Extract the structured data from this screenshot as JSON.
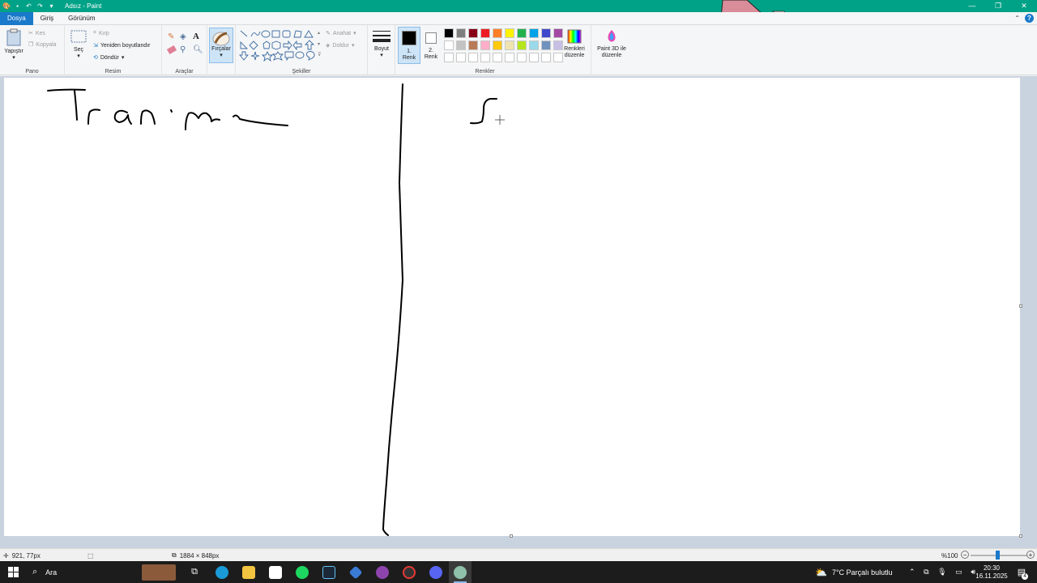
{
  "window": {
    "title": "Adsız - Paint",
    "controls": [
      "—",
      "❐",
      "✕"
    ]
  },
  "tabs": [
    {
      "label": "Dosya",
      "active": true
    },
    {
      "label": "Giriş"
    },
    {
      "label": "Görünüm"
    }
  ],
  "ribbon": {
    "clipboard": {
      "paste": "Yapıştır",
      "cut": "Kes",
      "copy": "Kopyala",
      "group": "Pano"
    },
    "image": {
      "select": "Seç",
      "crop": "Kırp",
      "resize": "Yeniden boyutlandır",
      "rotate": "Döndür",
      "group": "Resim"
    },
    "tools": {
      "group": "Araçlar"
    },
    "brushes": {
      "label": "Fırçalar"
    },
    "shapes": {
      "outline": "Anahat",
      "fill": "Doldur",
      "group": "Şekiller"
    },
    "size": {
      "label": "Boyut"
    },
    "colors": {
      "color1_label": "1. Renk",
      "color1_line1": "1.",
      "color1_line2": "Renk",
      "color2_line1": "2.",
      "color2_line2": "Renk",
      "edit_line1": "Renkleri",
      "edit_line2": "düzenle",
      "paint3d_line1": "Paint 3D ile",
      "paint3d_line2": "düzenle",
      "group": "Renkler",
      "color1": "#000000",
      "color2": "#ffffff",
      "palette_row1": [
        "#000000",
        "#7f7f7f",
        "#880015",
        "#ed1c24",
        "#ff7f27",
        "#fff200",
        "#22b14c",
        "#00a2e8",
        "#3f48cc",
        "#a349a4"
      ],
      "palette_row2": [
        "#ffffff",
        "#c3c3c3",
        "#b97a57",
        "#ffaec9",
        "#ffc90e",
        "#efe4b0",
        "#b5e61d",
        "#99d9ea",
        "#7092be",
        "#c8bfe7"
      ],
      "palette_row3": [
        "#ffffff",
        "#ffffff",
        "#ffffff",
        "#ffffff",
        "#ffffff",
        "#ffffff",
        "#ffffff",
        "#ffffff",
        "#ffffff",
        "#ffffff"
      ]
    }
  },
  "status": {
    "cursor_pos": "921, 77px",
    "canvas_size": "1884 × 848px",
    "zoom": "%100",
    "zoom_minus": "−",
    "zoom_plus": "+"
  },
  "taskbar": {
    "search_label": "Ara",
    "weather": "7°C  Parçalı bulutlu",
    "time": "20:30",
    "date": "16.11.2025",
    "notification_count": "4",
    "apps": [
      "task-view",
      "edge",
      "file-explorer",
      "store",
      "spotify",
      "steam",
      "app-blue",
      "app-purple",
      "app-red",
      "discord",
      "paint"
    ]
  }
}
